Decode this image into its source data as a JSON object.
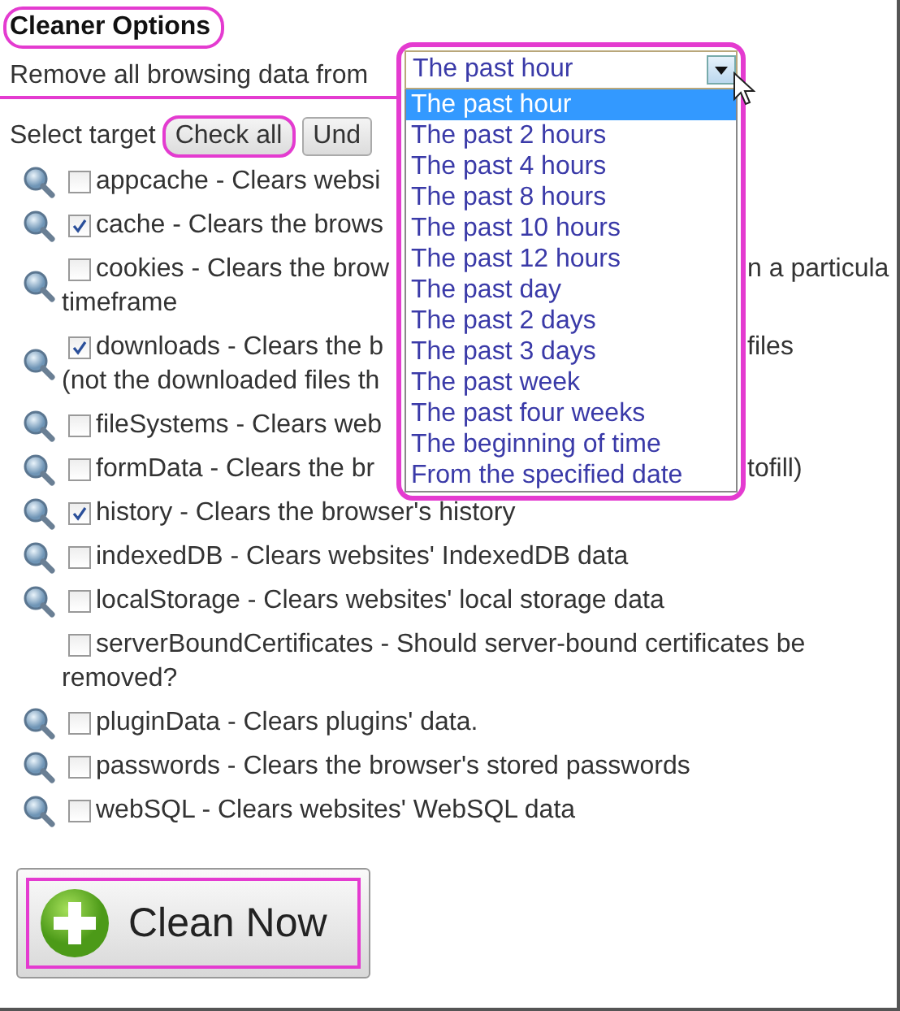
{
  "title": {
    "text": "Cleaner Options",
    "highlighted": true
  },
  "range": {
    "label": "Remove all browsing data from",
    "highlighted": true,
    "dropdown": {
      "value": "The past hour",
      "expanded": true,
      "highlighted": true,
      "options": [
        {
          "label": "The past hour",
          "selected": true
        },
        {
          "label": "The past 2 hours",
          "selected": false
        },
        {
          "label": "The past 4 hours",
          "selected": false
        },
        {
          "label": "The past 8 hours",
          "selected": false
        },
        {
          "label": "The past 10 hours",
          "selected": false
        },
        {
          "label": "The past 12 hours",
          "selected": false
        },
        {
          "label": "The past day",
          "selected": false
        },
        {
          "label": "The past 2 days",
          "selected": false
        },
        {
          "label": "The past 3 days",
          "selected": false
        },
        {
          "label": "The past week",
          "selected": false
        },
        {
          "label": "The past four weeks",
          "selected": false
        },
        {
          "label": "The beginning of time",
          "selected": false
        },
        {
          "label": "From the specified date",
          "selected": false
        }
      ]
    }
  },
  "target": {
    "label": "Select target",
    "buttons": [
      {
        "label": "Check all",
        "highlighted": true
      },
      {
        "label": "Und",
        "highlighted": false
      }
    ]
  },
  "items": [
    {
      "magnifier": true,
      "checked": false,
      "lines": [
        {
          "text": "appcache - Clears websi"
        }
      ]
    },
    {
      "magnifier": true,
      "checked": true,
      "lines": [
        {
          "text": "cache - Clears the brows"
        }
      ]
    },
    {
      "magnifier": true,
      "checked": false,
      "lines": [
        {
          "text": "cookies - Clears the brow",
          "after": "n a particula"
        },
        {
          "text": "timeframe"
        }
      ]
    },
    {
      "magnifier": true,
      "checked": true,
      "lines": [
        {
          "text": "downloads - Clears the b",
          "after": "files"
        },
        {
          "text": "(not the downloaded files th"
        }
      ]
    },
    {
      "magnifier": true,
      "checked": false,
      "lines": [
        {
          "text": "fileSystems - Clears web"
        }
      ]
    },
    {
      "magnifier": true,
      "checked": false,
      "lines": [
        {
          "text": "formData - Clears the br",
          "after": "tofill)"
        }
      ]
    },
    {
      "magnifier": true,
      "checked": true,
      "lines": [
        {
          "text": "history - Clears the browser's history"
        }
      ]
    },
    {
      "magnifier": true,
      "checked": false,
      "lines": [
        {
          "text": "indexedDB - Clears websites' IndexedDB data"
        }
      ]
    },
    {
      "magnifier": true,
      "checked": false,
      "lines": [
        {
          "text": "localStorage - Clears websites' local storage data"
        }
      ]
    },
    {
      "magnifier": false,
      "checked": false,
      "lines": [
        {
          "text": "serverBoundCertificates - Should server-bound certificates be"
        },
        {
          "text": "removed?"
        }
      ]
    },
    {
      "magnifier": true,
      "checked": false,
      "lines": [
        {
          "text": "pluginData - Clears plugins' data."
        }
      ]
    },
    {
      "magnifier": true,
      "checked": false,
      "lines": [
        {
          "text": "passwords - Clears the browser's stored passwords"
        }
      ]
    },
    {
      "magnifier": true,
      "checked": false,
      "lines": [
        {
          "text": "webSQL - Clears websites' WebSQL data"
        }
      ]
    }
  ],
  "clean_button": {
    "label": "Clean Now",
    "highlighted": true
  }
}
